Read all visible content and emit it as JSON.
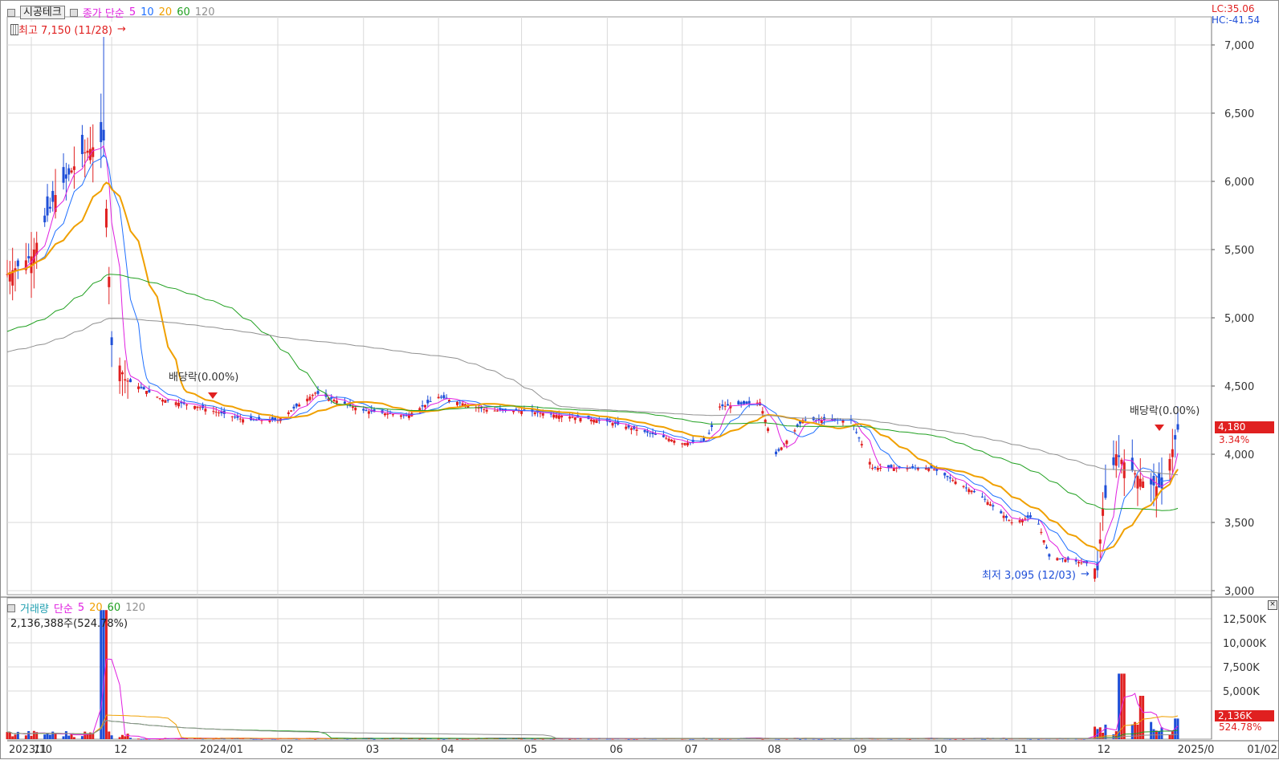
{
  "price_header": {
    "stock_name": "시공테크",
    "ma_label": "종가 단순",
    "ma_periods": [
      "5",
      "10",
      "20",
      "60",
      "120"
    ],
    "ma_colors": [
      "#e020e0",
      "#2070ff",
      "#f0a000",
      "#20a020",
      "#909090"
    ],
    "high_marker": "최고 7,150 (11/28)",
    "low_marker": "최저 3,095 (12/03)",
    "dividend_label_1": "배당락(0.00%)",
    "dividend_label_2": "배당락(0.00%)",
    "lc_label": "LC:35.06",
    "hc_label": "HC:-41.54"
  },
  "volume_header": {
    "title": "거래량",
    "ma_label": "단순",
    "ma_periods": [
      "5",
      "20",
      "60",
      "120"
    ],
    "ma_colors": [
      "#e020e0",
      "#f0a000",
      "#20a020",
      "#909090"
    ],
    "current_volume": "2,136,388주(524.78%)"
  },
  "current_price": {
    "price": "4,180",
    "change": "3.34%"
  },
  "current_volume_box": {
    "value": "2,136K",
    "pct": "524.78%"
  },
  "colors": {
    "up": "#e02020",
    "down": "#1f4fd8",
    "grid": "#d9d9d9",
    "axis": "#555555"
  },
  "chart_data": [
    {
      "type": "candlestick",
      "title": "시공테크",
      "y_ticks": [
        "3,000",
        "3,500",
        "4,000",
        "4,500",
        "5,000",
        "5,500",
        "6,000",
        "6,500",
        "7,000"
      ],
      "ylim": [
        3000,
        7000
      ],
      "x_labels": [
        "2023/10",
        "11",
        "12",
        "2024/01",
        "02",
        "03",
        "04",
        "05",
        "06",
        "07",
        "08",
        "09",
        "10",
        "11",
        "12",
        "2025/0",
        "01/02"
      ],
      "x_range": [
        "2023-10-23",
        "2025-01-02"
      ],
      "series_summary": [
        {
          "period": "2023/10",
          "close_approx": 5350
        },
        {
          "period": "11 early",
          "close_approx": 5800
        },
        {
          "period": "11/28 high",
          "high": 7150
        },
        {
          "period": "12 drop",
          "close_approx": 4500
        },
        {
          "period": "2024/01",
          "close_approx": 4300
        },
        {
          "period": "02",
          "close_approx": 4400
        },
        {
          "period": "03",
          "close_approx": 4300
        },
        {
          "period": "04",
          "close_approx": 4350
        },
        {
          "period": "05",
          "close_approx": 4300
        },
        {
          "period": "06",
          "close_approx": 4150
        },
        {
          "period": "07",
          "close_approx": 4100
        },
        {
          "period": "07 late",
          "close_approx": 4350
        },
        {
          "period": "08",
          "close_approx": 4250
        },
        {
          "period": "09",
          "close_approx": 3950
        },
        {
          "period": "10",
          "close_approx": 3900
        },
        {
          "period": "11",
          "close_approx": 3500
        },
        {
          "period": "11 late",
          "close_approx": 3250
        },
        {
          "period": "12/03 low",
          "low": 3095
        },
        {
          "period": "12",
          "close_approx": 4200
        },
        {
          "period": "2025/01/02",
          "close_approx": 4180
        }
      ]
    },
    {
      "type": "bar",
      "title": "거래량",
      "y_ticks": [
        "5,000K",
        "7,500K",
        "10,000K",
        "12,500K"
      ],
      "ylim": [
        0,
        14000
      ],
      "spikes": [
        {
          "period": "11/28",
          "value": 13400
        },
        {
          "period": "12 mid",
          "value": 6800
        },
        {
          "period": "12 late",
          "value": 4500
        },
        {
          "period": "01/02",
          "value": 2136
        }
      ]
    }
  ]
}
